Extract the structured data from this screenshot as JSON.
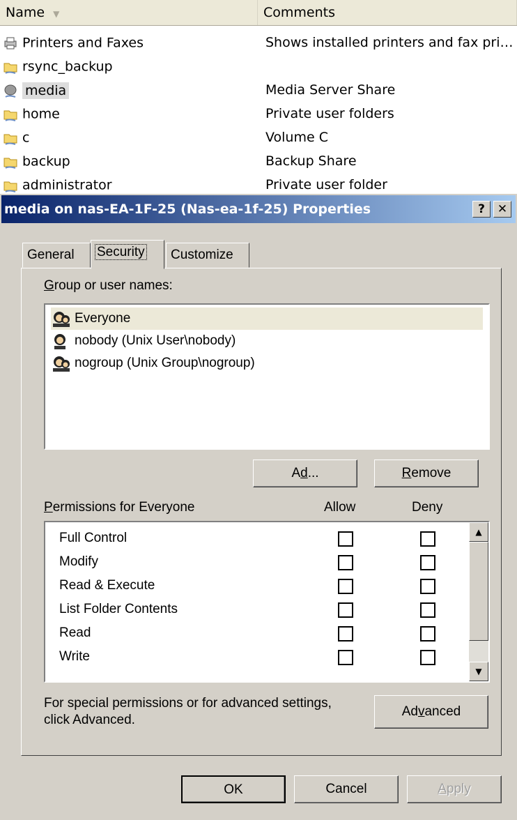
{
  "explorer": {
    "columns": {
      "name": "Name",
      "comments": "Comments"
    },
    "rows": [
      {
        "name": "Printers and Faxes",
        "comment": "Shows installed printers and fax pri…",
        "icon": "printer-icon"
      },
      {
        "name": "rsync_backup",
        "comment": "",
        "icon": "shared-folder-icon"
      },
      {
        "name": "media",
        "comment": "Media Server Share",
        "icon": "network-drive-icon"
      },
      {
        "name": "home",
        "comment": "Private user folders",
        "icon": "shared-folder-icon"
      },
      {
        "name": "c",
        "comment": "Volume C",
        "icon": "shared-folder-icon"
      },
      {
        "name": "backup",
        "comment": "Backup Share",
        "icon": "shared-folder-icon"
      },
      {
        "name": "administrator",
        "comment": "Private user folder",
        "icon": "shared-folder-icon"
      }
    ]
  },
  "dialog": {
    "title": "media on nas-EA-1F-25 (Nas-ea-1f-25) Properties",
    "help_label": "?",
    "close_label": "✕",
    "tabs": [
      {
        "label": "General"
      },
      {
        "label": "Security"
      },
      {
        "label": "Customize"
      }
    ],
    "group_label_hotkey": "G",
    "group_label_rest": "roup or user names:",
    "users": [
      {
        "name": "Everyone"
      },
      {
        "name": "nobody (Unix User\\nobody)"
      },
      {
        "name": "nogroup (Unix Group\\nogroup)"
      }
    ],
    "add_pre": "A",
    "add_hot": "d",
    "add_post": "d...",
    "remove_hot": "R",
    "remove_post": "emove",
    "perm_label_hot": "P",
    "perm_label_rest": "ermissions for Everyone",
    "allow_label": "Allow",
    "deny_label": "Deny",
    "permissions": [
      {
        "name": "Full Control",
        "allow": false,
        "deny": false
      },
      {
        "name": "Modify",
        "allow": false,
        "deny": false
      },
      {
        "name": "Read & Execute",
        "allow": false,
        "deny": false
      },
      {
        "name": "List Folder Contents",
        "allow": false,
        "deny": false
      },
      {
        "name": "Read",
        "allow": false,
        "deny": false
      },
      {
        "name": "Write",
        "allow": false,
        "deny": false
      }
    ],
    "advanced_text_1": "For special permissions or for advanced settings,",
    "advanced_text_2": "click Advanced.",
    "advanced_pre": "Ad",
    "advanced_hot": "v",
    "advanced_post": "anced",
    "ok_label": "OK",
    "cancel_label": "Cancel",
    "apply_hot": "A",
    "apply_post": "pply"
  }
}
